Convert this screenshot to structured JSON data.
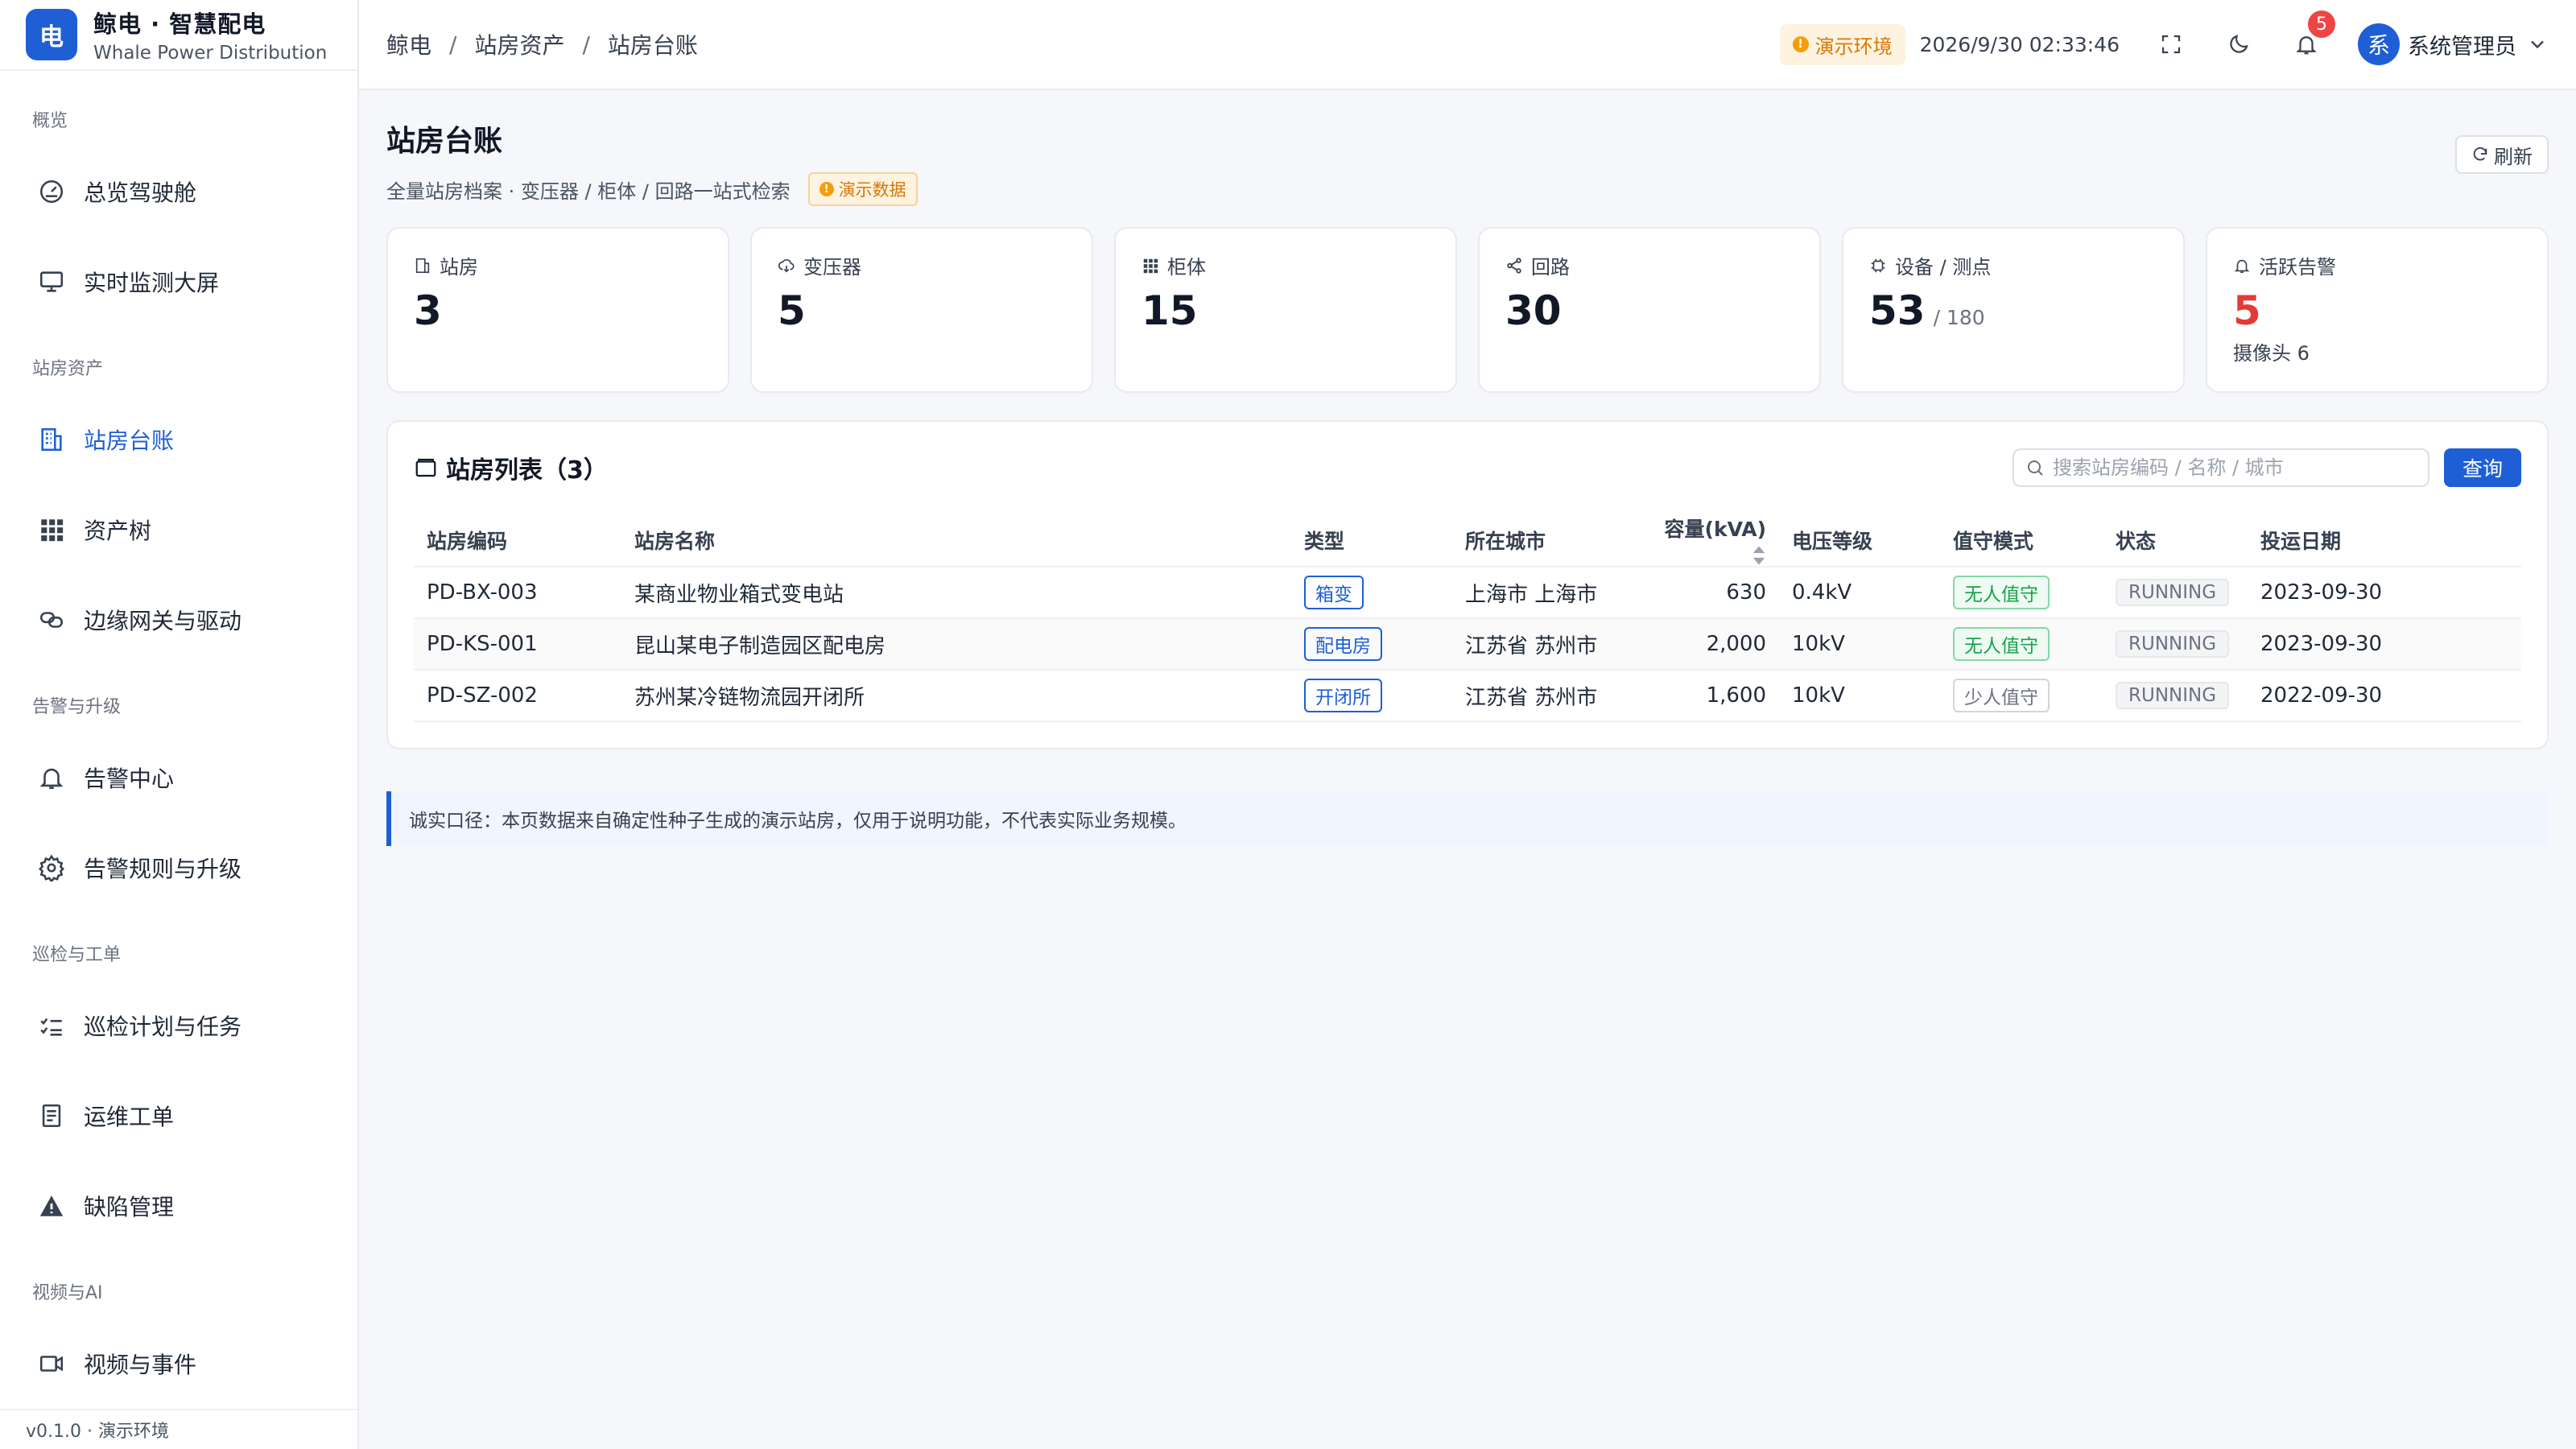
{
  "brand": {
    "logo_char": "电",
    "title": "鲸电 · 智慧配电",
    "subtitle": "Whale Power Distribution"
  },
  "sidebar": {
    "groups": [
      {
        "label": "概览",
        "items": [
          {
            "label": "总览驾驶舱",
            "icon": "dashboard-icon"
          },
          {
            "label": "实时监测大屏",
            "icon": "monitor-icon"
          }
        ]
      },
      {
        "label": "站房资产",
        "items": [
          {
            "label": "站房台账",
            "icon": "building-icon",
            "active": true
          },
          {
            "label": "资产树",
            "icon": "grid-icon"
          },
          {
            "label": "边缘网关与驱动",
            "icon": "link-icon"
          }
        ]
      },
      {
        "label": "告警与升级",
        "items": [
          {
            "label": "告警中心",
            "icon": "bell-icon"
          },
          {
            "label": "告警规则与升级",
            "icon": "gear-icon"
          }
        ]
      },
      {
        "label": "巡检与工单",
        "items": [
          {
            "label": "巡检计划与任务",
            "icon": "checklist-icon"
          },
          {
            "label": "运维工单",
            "icon": "document-icon"
          },
          {
            "label": "缺陷管理",
            "icon": "warning-icon"
          }
        ]
      },
      {
        "label": "视频与AI",
        "items": [
          {
            "label": "视频与事件",
            "icon": "video-icon"
          }
        ]
      }
    ],
    "footer": "v0.1.0 · 演示环境"
  },
  "breadcrumb": [
    "鲸电",
    "站房资产",
    "站房台账"
  ],
  "topbar": {
    "env_tag": "演示环境",
    "datetime": "2026/9/30 02:33:46",
    "notification_count": "5",
    "user_avatar": "系",
    "user_name": "系统管理员"
  },
  "page": {
    "title": "站房台账",
    "subtitle": "全量站房档案 · 变压器 / 柜体 / 回路一站式检索",
    "demo_tag": "演示数据",
    "refresh_label": "刷新"
  },
  "stats": [
    {
      "label": "站房",
      "value": "3",
      "icon": "building-icon"
    },
    {
      "label": "变压器",
      "value": "5",
      "icon": "transformer-icon"
    },
    {
      "label": "柜体",
      "value": "15",
      "icon": "grid-icon"
    },
    {
      "label": "回路",
      "value": "30",
      "icon": "share-icon"
    },
    {
      "label": "设备 / 测点",
      "value": "53",
      "unit": "/ 180",
      "icon": "chip-icon"
    },
    {
      "label": "活跃告警",
      "value": "5",
      "extra": "摄像头 6",
      "icon": "bell-icon",
      "color": "#e53935"
    }
  ],
  "table": {
    "title": "站房列表（3）",
    "search_placeholder": "搜索站房编码 / 名称 / 城市",
    "query_label": "查询",
    "columns": [
      "站房编码",
      "站房名称",
      "类型",
      "所在城市",
      "容量(kVA)",
      "电压等级",
      "值守模式",
      "状态",
      "投运日期"
    ],
    "rows": [
      {
        "code": "PD-BX-003",
        "name": "某商业物业箱式变电站",
        "type": "箱变",
        "city": "上海市 上海市",
        "capacity": "630",
        "voltage": "0.4kV",
        "mode": "无人值守",
        "status": "RUNNING",
        "date": "2023-09-30"
      },
      {
        "code": "PD-KS-001",
        "name": "昆山某电子制造园区配电房",
        "type": "配电房",
        "city": "江苏省 苏州市",
        "capacity": "2,000",
        "voltage": "10kV",
        "mode": "无人值守",
        "status": "RUNNING",
        "date": "2023-09-30"
      },
      {
        "code": "PD-SZ-002",
        "name": "苏州某冷链物流园开闭所",
        "type": "开闭所",
        "city": "江苏省 苏州市",
        "capacity": "1,600",
        "voltage": "10kV",
        "mode": "少人值守",
        "status": "RUNNING",
        "date": "2022-09-30"
      }
    ]
  },
  "note": "诚实口径：本页数据来自确定性种子生成的演示站房，仅用于说明功能，不代表实际业务规模。",
  "colors": {
    "primary": "#1e5fd6",
    "alert": "#e53935",
    "warning": "#f59e0b",
    "success": "#16a34a"
  }
}
